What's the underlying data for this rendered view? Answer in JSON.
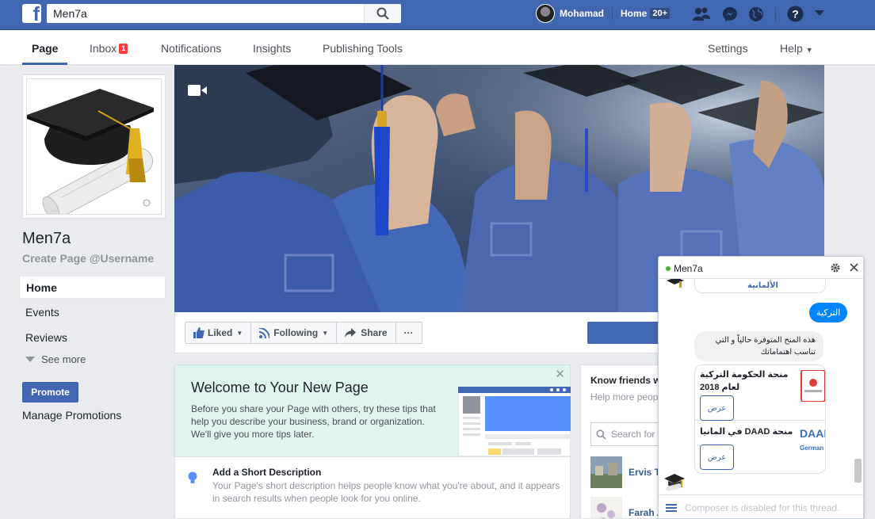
{
  "topbar": {
    "logo": "f",
    "search_value": "Men7a",
    "user_name": "Mohamad",
    "home_label": "Home",
    "home_count": "20+"
  },
  "nav": {
    "tabs": [
      {
        "label": "Page"
      },
      {
        "label": "Inbox",
        "badge": "1"
      },
      {
        "label": "Notifications"
      },
      {
        "label": "Insights"
      },
      {
        "label": "Publishing Tools"
      }
    ],
    "settings": "Settings",
    "help": "Help"
  },
  "left": {
    "page_name": "Men7a",
    "username_link": "Create Page @Username",
    "items": [
      {
        "label": "Home"
      },
      {
        "label": "Events"
      },
      {
        "label": "Reviews"
      }
    ],
    "see_more": "See more",
    "promote": "Promote",
    "manage_promotions": "Manage Promotions"
  },
  "actions": {
    "liked": "Liked",
    "following": "Following",
    "share": "Share",
    "more": "···"
  },
  "welcome": {
    "title": "Welcome to Your New Page",
    "text": "Before you share your Page with others, try these tips that help you describe your business, brand or organization. We'll give you more tips later.",
    "close": "✕",
    "tip_title": "Add a Short Description",
    "tip_text": "Your Page's short description helps people know what you're about, and it appears in search results when people look for you online."
  },
  "friends": {
    "title": "Know friends w",
    "text": "Help more peopl friends to like it.",
    "search_placeholder": "Search for",
    "people": [
      {
        "name": "Ervis T"
      },
      {
        "name": "Farah A"
      }
    ]
  },
  "chat": {
    "title": "Men7a",
    "partial_card_text": "الألمانية",
    "user_message": "التركية",
    "bot_message": "هذه المنح المتوفرة حالياً و التي تناسب اهتماماتك",
    "cards": [
      {
        "title": "منحة الحكومة التركية لعام 2018",
        "button": "عرض"
      },
      {
        "title": "منحة DAAD في المانيا",
        "button": "عرض",
        "logo": "DAAD",
        "logo_sub": "German"
      }
    ],
    "composer_placeholder": "Composer is disabled for this thread."
  }
}
